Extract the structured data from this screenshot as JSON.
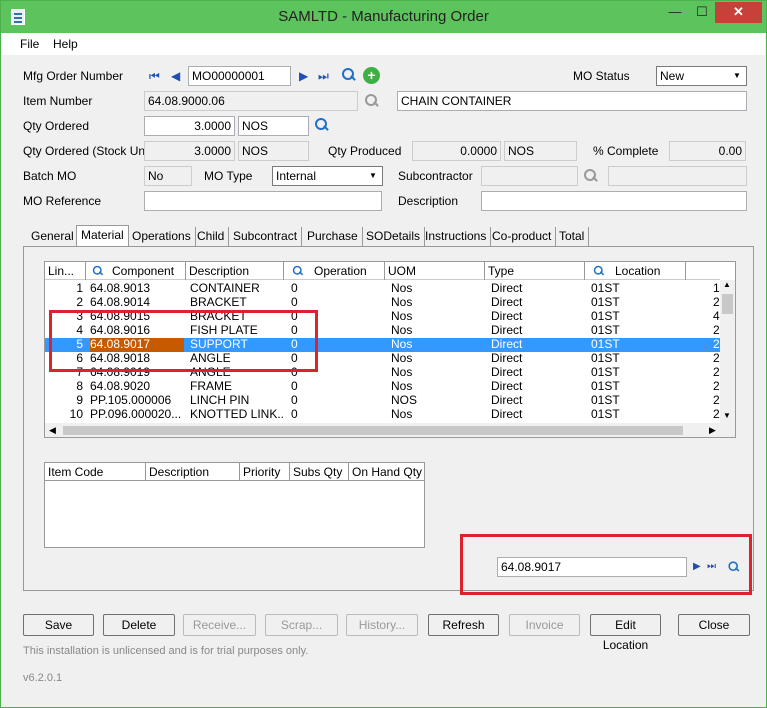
{
  "window": {
    "title": "SAMLTD - Manufacturing Order",
    "min": "—",
    "max": "☐",
    "close": "✕"
  },
  "menu": {
    "file": "File",
    "help": "Help"
  },
  "form": {
    "mfg_order_label": "Mfg Order Number",
    "mfg_order_value": "MO00000001",
    "mo_status_label": "MO Status",
    "mo_status_value": "New",
    "item_number_label": "Item Number",
    "item_number_value": "64.08.9000.06",
    "item_desc_value": "CHAIN CONTAINER",
    "qty_ordered_label": "Qty Ordered",
    "qty_ordered_value": "3.0000",
    "qty_unit": "NOS",
    "qty_stock_label": "Qty Ordered (Stock Unit)",
    "qty_stock_value": "3.0000",
    "qty_stock_unit": "NOS",
    "qty_produced_label": "Qty Produced",
    "qty_produced_value": "0.0000",
    "qty_produced_unit": "NOS",
    "pct_complete_label": "% Complete",
    "pct_complete_value": "0.00",
    "batch_mo_label": "Batch MO",
    "batch_mo_value": "No",
    "mo_type_label": "MO Type",
    "mo_type_value": "Internal",
    "subcontractor_label": "Subcontractor",
    "mo_reference_label": "MO Reference",
    "description_label": "Description"
  },
  "tabs": [
    "General",
    "Material",
    "Operations",
    "Child",
    "Subcontract",
    "Purchase",
    "SODetails",
    "Instructions",
    "Co-product",
    "Total"
  ],
  "material": {
    "headers": [
      "Lin...",
      "Component",
      "Description",
      "Operation",
      "UOM",
      "Type",
      "Location"
    ],
    "rows": [
      {
        "n": "1",
        "comp": "64.08.9013",
        "desc": "CONTAINER",
        "op": "0",
        "uom": "Nos",
        "type": "Direct",
        "loc": "01ST",
        "x": "1"
      },
      {
        "n": "2",
        "comp": "64.08.9014",
        "desc": "BRACKET",
        "op": "0",
        "uom": "Nos",
        "type": "Direct",
        "loc": "01ST",
        "x": "2"
      },
      {
        "n": "3",
        "comp": "64.08.9015",
        "desc": "BRACKET",
        "op": "0",
        "uom": "Nos",
        "type": "Direct",
        "loc": "01ST",
        "x": "4"
      },
      {
        "n": "4",
        "comp": "64.08.9016",
        "desc": "FISH PLATE",
        "op": "0",
        "uom": "Nos",
        "type": "Direct",
        "loc": "01ST",
        "x": "2"
      },
      {
        "n": "5",
        "comp": "64.08.9017",
        "desc": "SUPPORT",
        "op": "0",
        "uom": "Nos",
        "type": "Direct",
        "loc": "01ST",
        "x": "2"
      },
      {
        "n": "6",
        "comp": "64.08.9018",
        "desc": "ANGLE",
        "op": "0",
        "uom": "Nos",
        "type": "Direct",
        "loc": "01ST",
        "x": "2"
      },
      {
        "n": "7",
        "comp": "64.08.9019",
        "desc": "ANGLE",
        "op": "0",
        "uom": "Nos",
        "type": "Direct",
        "loc": "01ST",
        "x": "2"
      },
      {
        "n": "8",
        "comp": "64.08.9020",
        "desc": "FRAME",
        "op": "0",
        "uom": "Nos",
        "type": "Direct",
        "loc": "01ST",
        "x": "2"
      },
      {
        "n": "9",
        "comp": "PP.105.000006",
        "desc": "LINCH PIN",
        "op": "0",
        "uom": "NOS",
        "type": "Direct",
        "loc": "01ST",
        "x": "2"
      },
      {
        "n": "10",
        "comp": "PP.096.000020...",
        "desc": "KNOTTED LINK...",
        "op": "0",
        "uom": "Nos",
        "type": "Direct",
        "loc": "01ST",
        "x": "2"
      }
    ]
  },
  "subgrid": {
    "headers": [
      "Item Code",
      "Description",
      "Priority",
      "Subs Qty",
      "On Hand Qty"
    ]
  },
  "finder": {
    "value": "64.08.9017"
  },
  "buttons": [
    "Save",
    "Delete",
    "Receive...",
    "Scrap...",
    "History...",
    "Refresh",
    "Invoice",
    "Edit Location",
    "Close"
  ],
  "footer": {
    "notice": "This installation is unlicensed and is for trial purposes only.",
    "version": "v6.2.0.1"
  },
  "colors": {
    "titlebar": "#5dc35d",
    "selected_row": "#3399ff",
    "highlight_cell": "#c65a00",
    "annotation": "#e0202a"
  }
}
